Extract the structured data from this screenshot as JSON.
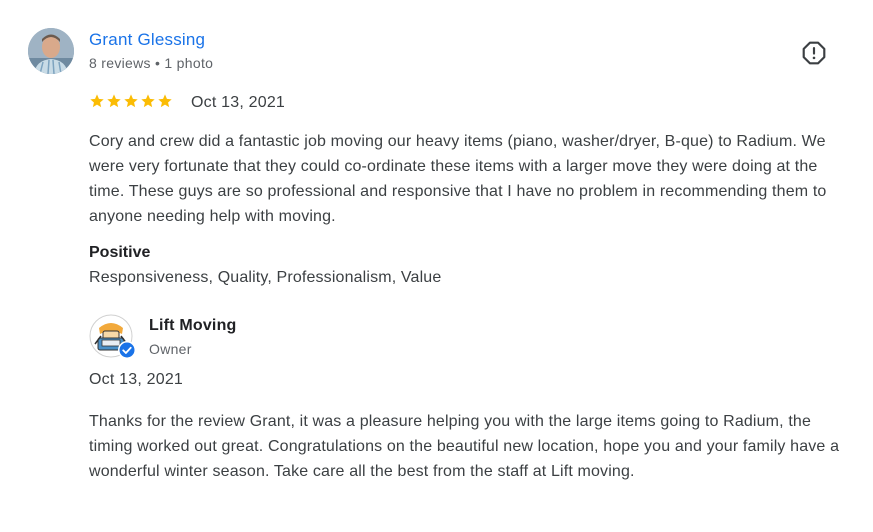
{
  "review": {
    "reviewer_name": "Grant Glessing",
    "reviewer_meta": "8 reviews • 1 photo",
    "rating": 5,
    "date": "Oct 13, 2021",
    "text": "Cory and crew did a fantastic job moving our heavy items (piano, washer/dryer, B-que) to Radium. We were very fortunate that they could co-ordinate these items with a larger move they were doing at the time. These guys are so professional and responsive that I have no problem in recommending them to anyone needing help with moving.",
    "positive_title": "Positive",
    "positive_values": "Responsiveness, Quality, Professionalism, Value",
    "report_icon": "report-icon",
    "star_color": "#fbbc04"
  },
  "owner_response": {
    "owner_name": "Lift Moving",
    "owner_role": "Owner",
    "verified_icon": "verified-badge-icon",
    "verified_color": "#1a73e8",
    "date": "Oct 13, 2021",
    "text": "Thanks for the review Grant, it was a pleasure helping you with the large items going to Radium, the timing worked out great. Congratulations on the beautiful new location, hope you and your family have a wonderful winter season. Take care all the best from the staff at Lift moving."
  }
}
